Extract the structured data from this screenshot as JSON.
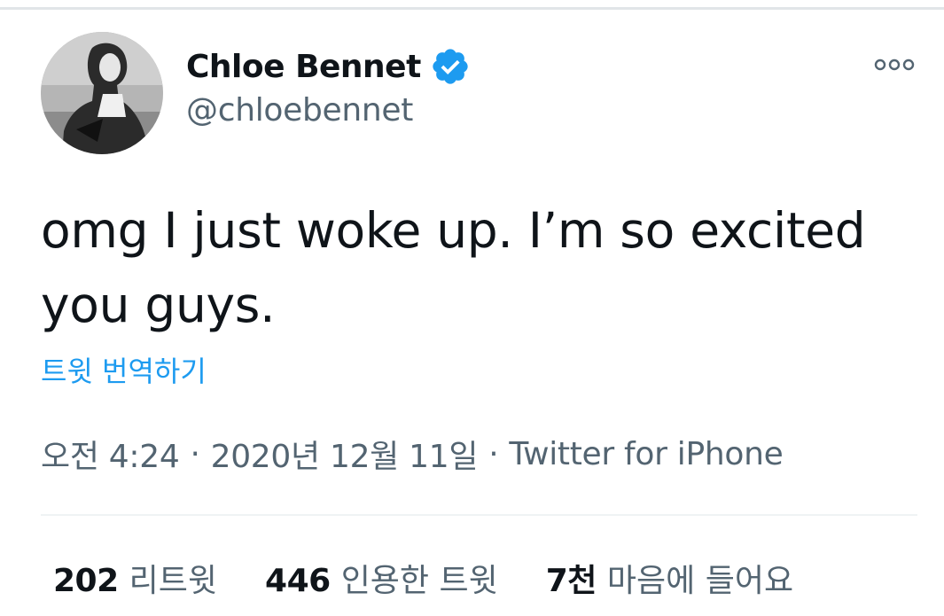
{
  "author": {
    "display_name": "Chloe Bennet",
    "handle": "@chloebennet",
    "verified": true,
    "verified_color": "#1d9bf0"
  },
  "tweet": {
    "text": "omg I just woke up. I’m so excited you guys.",
    "translate_label": "트윗 번역하기",
    "time": "오전 4:24",
    "date": "2020년 12월 11일",
    "separator": "·",
    "source": "Twitter for iPhone"
  },
  "stats": {
    "retweets": {
      "count": "202",
      "label": "리트윗"
    },
    "quotes": {
      "count": "446",
      "label": "인용한 트윗"
    },
    "likes": {
      "count": "7천",
      "label": "마음에 들어요"
    }
  },
  "icons": {
    "more": "more-options-icon",
    "verified": "verified-badge-icon"
  },
  "colors": {
    "text_primary": "#0f1419",
    "text_secondary": "#536471",
    "link": "#1d9bf0",
    "divider": "#eff3f4"
  }
}
